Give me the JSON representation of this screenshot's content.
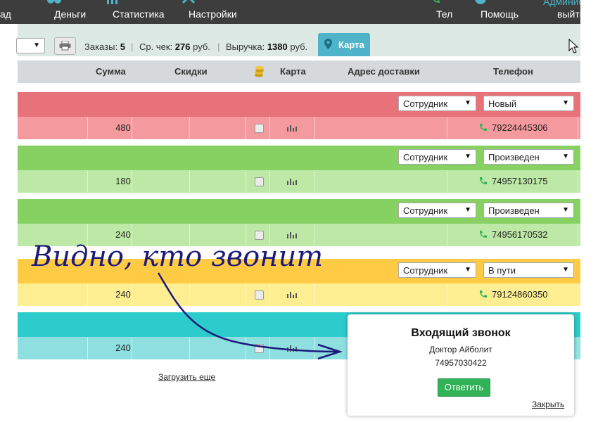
{
  "nav": {
    "partial_left": "ад",
    "items": [
      {
        "label": "Деньги"
      },
      {
        "label": "Статистика"
      },
      {
        "label": "Настройки"
      }
    ],
    "right_items": [
      {
        "label": "Тел"
      },
      {
        "label": "Помощь"
      }
    ],
    "user_partial": "Админис",
    "logout_partial": "выйти"
  },
  "toolbar": {
    "stats": [
      {
        "label": "Заказы:",
        "value": "5"
      },
      {
        "label": "Ср. чек:",
        "value": "276",
        "unit": "руб."
      },
      {
        "label": "Выручка:",
        "value": "1380",
        "unit": "руб."
      }
    ],
    "map_tab": "Карта"
  },
  "table": {
    "columns": [
      "Сумма",
      "Скидки",
      "",
      "Карта",
      "Адрес доставки",
      "Телефон"
    ],
    "orders": [
      {
        "employee": "Сотрудник",
        "status": "Новый",
        "sum": "480",
        "phone": "79224445306",
        "band_color": "#e8727a",
        "row_color": "#f4999e"
      },
      {
        "employee": "Сотрудник",
        "status": "Произведен",
        "sum": "180",
        "phone": "74957130175",
        "band_color": "#86d161",
        "row_color": "#bde8a5"
      },
      {
        "employee": "Сотрудник",
        "status": "Произведен",
        "sum": "240",
        "phone": "74956170532",
        "band_color": "#86d161",
        "row_color": "#bde8a5"
      },
      {
        "employee": "Сотрудник",
        "status": "В пути",
        "sum": "240",
        "phone": "79124860350",
        "band_color": "#ffcb44",
        "row_color": "#fdee92"
      },
      {
        "employee": "",
        "status": "",
        "sum": "240",
        "phone": "",
        "band_color": "#2ccccc",
        "row_color": "#8ee0e0"
      }
    ]
  },
  "load_more": "Загрузить еще",
  "popup": {
    "title": "Входящий звонок",
    "caller": "Доктор Айболит",
    "number": "74957030422",
    "answer": "Ответить",
    "close": "Закрыть"
  },
  "annotation": "Видно, кто звонит"
}
